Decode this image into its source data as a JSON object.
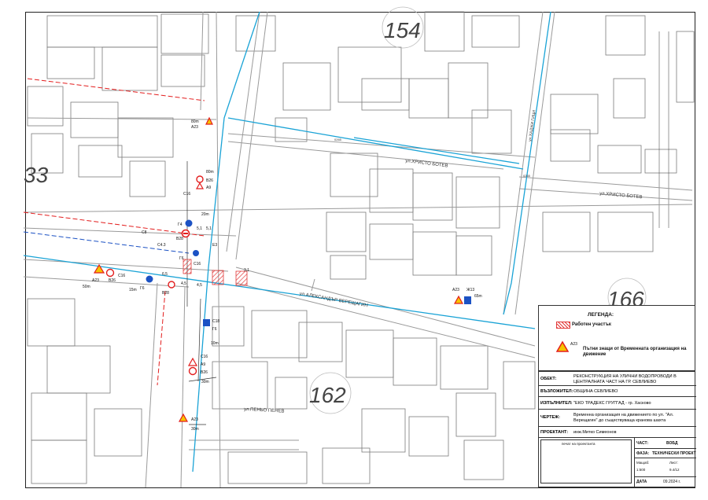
{
  "blocks": {
    "b154": "154",
    "b33": "33",
    "b162": "162",
    "b166": "166"
  },
  "streets": {
    "hristo_botev": "ул.ХРИСТО БОТЕВ",
    "hristo_botev_east": "ул.ХРИСТО БОТЕВ",
    "vereshchagin": "ул.АЛЕКСАНДЪР ВЕРЕЩАГИН",
    "penev": "ул.ПЕНЬО ПЕНЕВ",
    "hadzhi": "ул.ХАДЖИ ГИЦИ"
  },
  "signs": {
    "a23_top": "A23",
    "dist_80m": "80m",
    "v26": "B26",
    "a9": "A9",
    "dist_80m_b": "80m",
    "c16_top": "C16",
    "g4": "Г4",
    "v28": "B28",
    "c8": "C8",
    "c43": "C4.3",
    "g6": "Г6",
    "c16_mid": "C16",
    "v26_left": "B26",
    "a23_left": "A23",
    "c16_left": "C16",
    "dist_50m": "50m",
    "g6_b": "Г6",
    "v28_b": "B28",
    "a23_right": "A23",
    "zh13": "Ж13",
    "dist_65m": "65m",
    "c18": "C18",
    "g6_c": "Г6",
    "dist_10m": "10m",
    "c16_low": "C16",
    "a9_low": "A9",
    "v26_low": "B26",
    "dist_30m": "30m",
    "a23_bottom": "A23",
    "dist_30m_b": "30m",
    "e3": "E3",
    "d51": "5,1",
    "d51b": "5,1",
    "d45": "4,5",
    "d65": "6,5",
    "d31": "3,1",
    "dist_15m": "15m",
    "dist_20m": "20m",
    "d055": "0265",
    "d096": "0265"
  },
  "legend": {
    "title": "ЛЕГЕНДА:",
    "work_area": "Работен участък",
    "sign_code": "A23",
    "road_signs": "Пътни знаци от Временната организация на движение"
  },
  "titleblock": {
    "obekt_label": "ОБЕКТ:",
    "obekt_value": "РЕКОНСТРУКЦИЯ НА УЛИЧНИ ВОДОПРОВОДИ В ЦЕНТРАЛНАТА ЧАСТ НА ГР. СЕВЛИЕВО",
    "vazlozhitel_label": "ВЪЗЛОЖИТЕЛ:",
    "vazlozhitel_value": "ОБЩИНА СЕВЛИЕВО",
    "izpalnitel_label": "ИЗПЪЛНИТЕЛ:",
    "izpalnitel_value": "\"ЕКО ТРАДЕКС ГРУП\"АД - гр. Хасково",
    "chertezh_label": "ЧЕРТЕЖ:",
    "chertezh_value": "Временна организация на движението по ул. \"Ал. Верещагин\" до съществуваща кранова шахта",
    "proektant_label": "ПРОЕКТАНТ:",
    "proektant_value": "инж.Митко Симеонов",
    "stamp": "печат на проектанта",
    "chast_label": "ЧАСТ:",
    "chast_value": "ВОБД",
    "faza_label": "ФАЗА:",
    "faza_value": "ТЕХНИЧЕСКИ ПРОЕКТ",
    "mashtab_label": "Мащаб:",
    "mashtab_value": "1:500",
    "list_label": "Лист:",
    "list_value": "9.4/12",
    "data_label": "ДАТА",
    "data_value": "09.2024 г."
  },
  "colors": {
    "water": "#1aa3d6",
    "sign_blue": "#1c52c4",
    "sign_red": "#e31d1d",
    "sign_yellow": "#f5c400",
    "work_hatch": "#e23a3a",
    "road_grey": "#9a9a9a"
  }
}
